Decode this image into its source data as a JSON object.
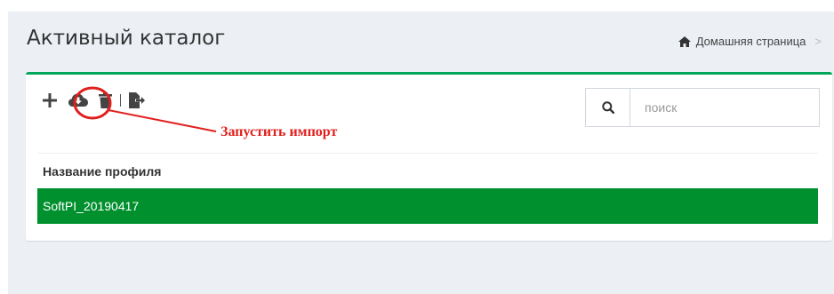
{
  "header": {
    "title": "Активный каталог"
  },
  "breadcrumb": {
    "home_label": "Домашняя страница",
    "separator": ">"
  },
  "toolbar": {
    "buttons": [
      {
        "name": "add-button",
        "icon": "plus-icon"
      },
      {
        "name": "import-button",
        "icon": "cloud-download-icon"
      },
      {
        "name": "delete-button",
        "icon": "trash-icon"
      },
      {
        "name": "export-button",
        "icon": "file-export-icon"
      }
    ]
  },
  "search": {
    "placeholder": "поиск",
    "icon": "search-icon"
  },
  "annotation": {
    "label": "Запустить импорт",
    "color": "#e0201e"
  },
  "table": {
    "columns": [
      "Название профиля"
    ],
    "rows": [
      {
        "name": "SoftPI_20190417",
        "selected": true
      }
    ]
  },
  "colors": {
    "accent": "#00a65a",
    "row_selected": "#00902e",
    "background": "#ecf0f5"
  }
}
